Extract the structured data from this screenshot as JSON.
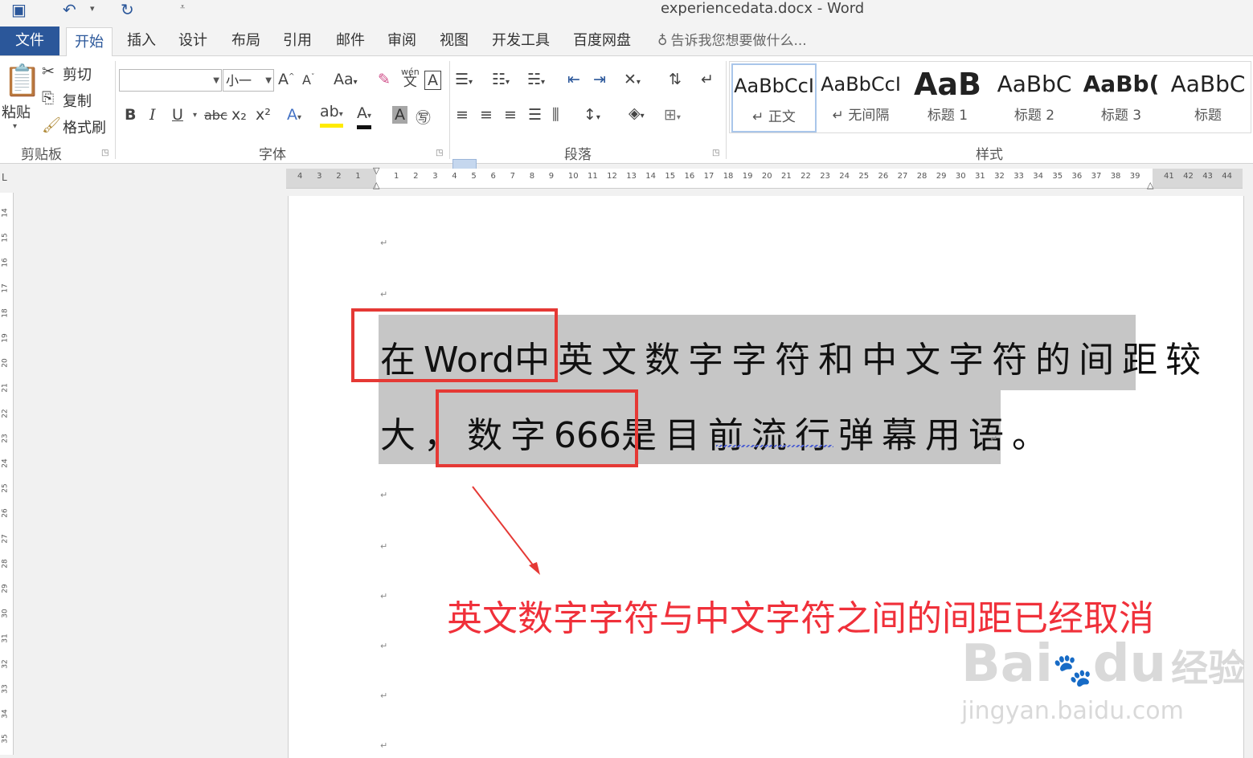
{
  "window": {
    "title": "experiencedata.docx - Word"
  },
  "quick_access": {
    "save_icon": "save-icon",
    "undo_icon": "undo-icon",
    "redo_icon": "redo-icon",
    "customize_icon": "customize-icon"
  },
  "tabs": {
    "file": "文件",
    "items": [
      "开始",
      "插入",
      "设计",
      "布局",
      "引用",
      "邮件",
      "审阅",
      "视图",
      "开发工具",
      "百度网盘"
    ],
    "tell_me": "告诉我您想要做什么..."
  },
  "clipboard": {
    "paste": "粘贴",
    "cut": "剪切",
    "copy": "复制",
    "format_painter": "格式刷",
    "label": "剪贴板"
  },
  "font": {
    "font_name": "",
    "font_size": "小一",
    "change_case": "Aa",
    "bold": "B",
    "italic": "I",
    "underline": "U",
    "strike": "abc",
    "subscript": "x₂",
    "superscript": "x²",
    "phonetic": "wén",
    "phonetic_char": "文",
    "char_border": "A",
    "label": "字体"
  },
  "paragraph": {
    "label": "段落"
  },
  "styles": {
    "label": "样式",
    "items": [
      {
        "sample": "AaBbCcI",
        "name": "↵ 正文"
      },
      {
        "sample": "AaBbCcI",
        "name": "↵ 无间隔"
      },
      {
        "sample": "AaB",
        "name": "标题 1"
      },
      {
        "sample": "AaBbC",
        "name": "标题 2"
      },
      {
        "sample": "AaBb(",
        "name": "标题 3"
      },
      {
        "sample": "AaBbC",
        "name": "标题"
      }
    ]
  },
  "ruler": {
    "left_ticks": [
      "4",
      "3",
      "2",
      "1"
    ],
    "ticks": [
      "1",
      "2",
      "3",
      "4",
      "5",
      "6",
      "7",
      "8",
      "9",
      "10",
      "11",
      "12",
      "13",
      "14",
      "15",
      "16",
      "17",
      "18",
      "19",
      "20",
      "21",
      "22",
      "23",
      "24",
      "25",
      "26",
      "27",
      "28",
      "29",
      "30",
      "31",
      "32",
      "33",
      "34",
      "35",
      "36",
      "37",
      "38",
      "39"
    ],
    "right_ticks": [
      "41",
      "42",
      "43",
      "44"
    ],
    "vertical_ticks": [
      "14",
      "15",
      "16",
      "17",
      "18",
      "19",
      "20",
      "21",
      "22",
      "23",
      "24",
      "25",
      "26",
      "27",
      "28",
      "29",
      "30",
      "31",
      "32",
      "33",
      "34",
      "35"
    ]
  },
  "document": {
    "paragraph_mark": "↵",
    "line1": {
      "a": "在",
      "b": "Word",
      "c": "中英文数字字符和中文字符的间距较"
    },
    "line2": {
      "a": "大，",
      "b": "数字",
      "c": "666",
      "d": "是目前流行弹幕用语。"
    },
    "annotation": "英文数字字符与中文字符之间的间距已经取消"
  },
  "watermark": {
    "brand": "Bai",
    "brand2": "du",
    "brand_cn": "经验",
    "url": "jingyan.baidu.com"
  },
  "colors": {
    "accent": "#2b579a",
    "highlight_red": "#e53935",
    "annotation_red": "#f0303a",
    "selection": "#c6c6c6"
  }
}
